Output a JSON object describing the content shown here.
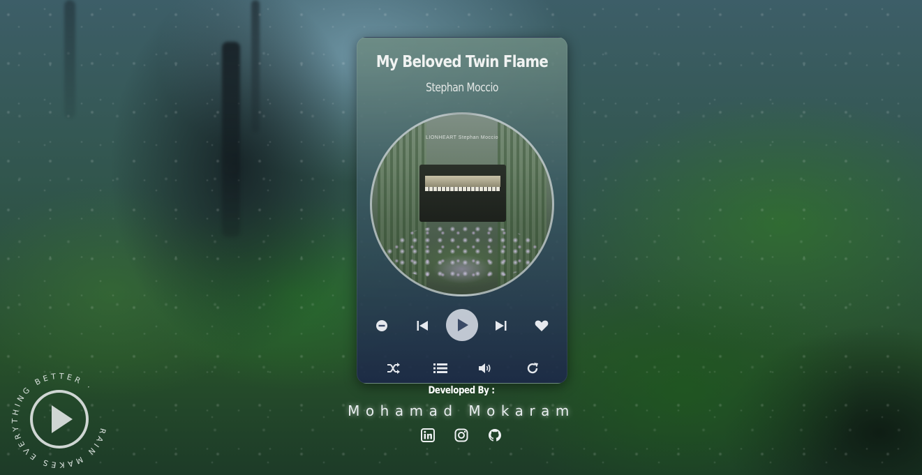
{
  "track": {
    "title": "My Beloved Twin Flame",
    "artist": "Stephan Moccio",
    "cover_logo": "LIONHEART  Stephan Moccio"
  },
  "controls": {
    "row1": [
      "remove-icon",
      "previous-icon",
      "play-icon",
      "next-icon",
      "heart-icon"
    ],
    "row2": [
      "shuffle-icon",
      "playlist-icon",
      "volume-icon",
      "repeat-icon"
    ]
  },
  "footer": {
    "developed_by_label": "Developed By :",
    "developer_name": "Mohamad Mokaram",
    "socials": [
      "linkedin-icon",
      "instagram-icon",
      "github-icon"
    ]
  },
  "badge": {
    "circular_text": "RAIN MAKES EVERYTHING BETTER ·",
    "icon": "play-icon"
  },
  "colors": {
    "player_top": "#6e8c82",
    "player_bottom": "#1c2848",
    "icon": "#e6e9ee",
    "play_button": "#d2d7e1"
  }
}
